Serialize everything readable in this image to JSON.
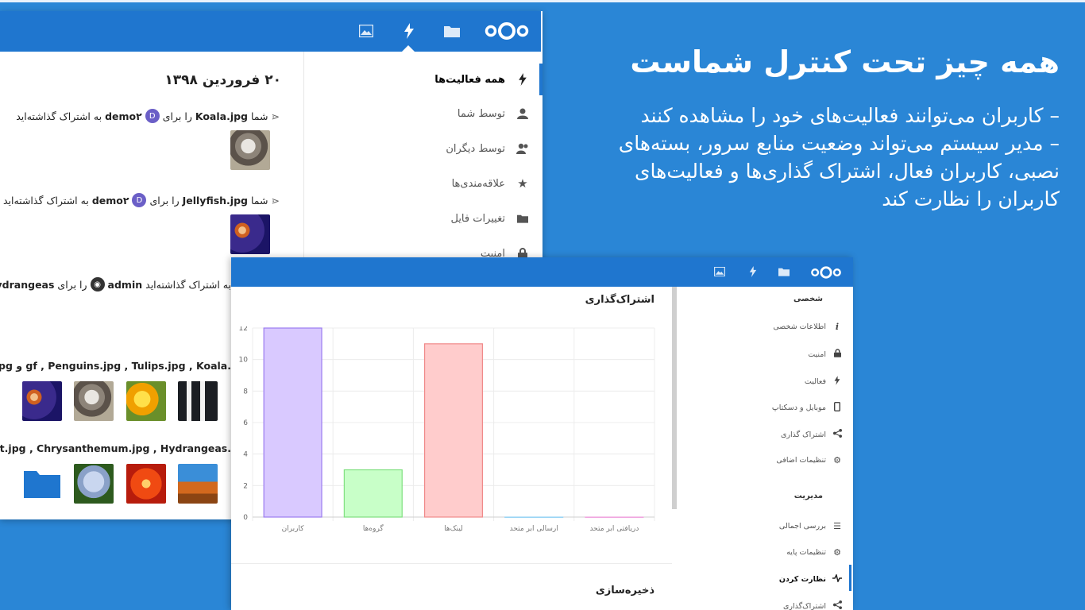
{
  "headline": {
    "title": "همه چیز تحت کنترل شماست",
    "line1": "– کاربران می‌توانند فعالیت‌های خود را مشاهده کنند",
    "line2": "– مدیر سیستم می‌تواند وضعیت منابع سرور، بسته‌های نصبی، کاربران فعال، اشتراک گذاری‌ها و فعالیت‌های کاربران را نظارت کند"
  },
  "activity_app": {
    "header_icons": [
      "nextcloud-logo-icon",
      "folder-icon",
      "lightning-icon",
      "image-icon"
    ],
    "nav": [
      {
        "label": "همه فعالیت‌ها",
        "icon": "lightning-icon",
        "active": true
      },
      {
        "label": "توسط شما",
        "icon": "user-icon",
        "active": false
      },
      {
        "label": "توسط دیگران",
        "icon": "users-icon",
        "active": false
      },
      {
        "label": "علاقه‌مندی‌ها",
        "icon": "star-icon",
        "active": false
      },
      {
        "label": "تغییرات فایل",
        "icon": "folder-icon",
        "active": false
      },
      {
        "label": "امنیت",
        "icon": "lock-icon",
        "active": false
      }
    ],
    "date": "۲۰ فروردین ۱۳۹۸",
    "entries": [
      {
        "you": "شما",
        "file": "Koala.jpg",
        "for": "را برای",
        "avatar": "D",
        "user": "demo۲",
        "suffix": "به اشتراک گذاشته‌اید"
      },
      {
        "you": "شما",
        "file": "Jellyfish.jpg",
        "for": "را برای",
        "avatar": "D",
        "user": "demo۲",
        "suffix": "به اشتراک گذاشته‌اید"
      },
      {
        "file": "Hydrangeas.",
        "for": "را برای",
        "user": "admin",
        "suffix": "به اشتراک گذاشته‌اید"
      }
    ],
    "files_line_1": "llyfish.jpg و gf , Penguins.jpg , Tulips.jpg , Koala.",
    "files_line_2": "Desert.jpg , Chrysanthemum.jpg , Hydrangeas."
  },
  "admin_app": {
    "header_icons": [
      "nextcloud-logo-icon",
      "folder-icon",
      "lightning-icon",
      "image-icon"
    ],
    "section_sharing": "اشتراک‌گذاری",
    "section_storage": "ذخیره‌سازی",
    "sidebar": {
      "personal_heading": "شخصی",
      "personal_items": [
        {
          "label": "اطلاعات شخصی",
          "icon": "info-icon"
        },
        {
          "label": "امنیت",
          "icon": "lock-icon"
        },
        {
          "label": "فعالیت",
          "icon": "lightning-icon"
        },
        {
          "label": "موبایل و دسکتاپ",
          "icon": "phone-icon"
        },
        {
          "label": "اشتراک گذاری",
          "icon": "share-icon"
        },
        {
          "label": "تنظیمات اضافی",
          "icon": "gear-icon"
        }
      ],
      "admin_heading": "مدیریت",
      "admin_items": [
        {
          "label": "بررسی اجمالی",
          "icon": "list-icon",
          "active": false
        },
        {
          "label": "تنظیمات پایه",
          "icon": "gear-icon",
          "active": false
        },
        {
          "label": "نظارت کردن",
          "icon": "pulse-icon",
          "active": true
        },
        {
          "label": "اشتراک‌گذاری",
          "icon": "share-icon",
          "active": false
        }
      ]
    }
  },
  "chart_data": {
    "type": "bar",
    "categories": [
      "کاربران",
      "گروه‌ها",
      "لینک‌ها",
      "ارسالی ابر متحد",
      "دریافتی ابر متحد"
    ],
    "values": [
      12,
      3,
      11,
      0,
      0
    ],
    "ylim": [
      0,
      12
    ],
    "yticks": [
      0,
      2,
      4,
      6,
      8,
      10,
      12
    ],
    "colors": [
      "#d9c9ff",
      "#c8ffc8",
      "#ffcccc",
      "#cceeff",
      "#ffd9f5"
    ],
    "border_colors": [
      "#9b7cf0",
      "#7fe07f",
      "#f08a8a",
      "#9ad4f5",
      "#f0a6e0"
    ],
    "grid": true,
    "legend": "none"
  }
}
